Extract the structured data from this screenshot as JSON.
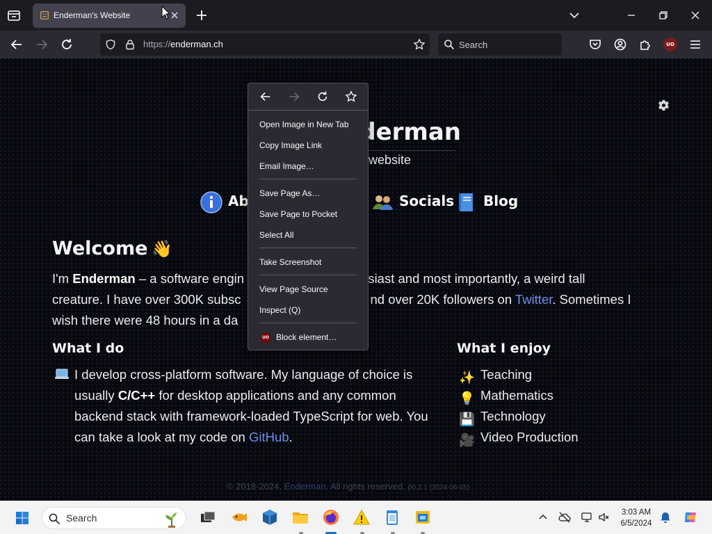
{
  "browser": {
    "tab": {
      "title": "Enderman's Website"
    },
    "url": {
      "protocol": "https://",
      "host": "enderman.ch"
    },
    "search_placeholder": "Search",
    "ublock_badge": "UO"
  },
  "page": {
    "site_title": "nderman",
    "site_subtitle": "website",
    "nav": [
      {
        "label": "Abo"
      },
      {
        "label": "Socials"
      },
      {
        "label": "Blog"
      }
    ],
    "welcome": {
      "heading": "Welcome",
      "emoji": "👋"
    },
    "intro": {
      "p1": "I'm ",
      "name": "Enderman",
      "p2": " – a software engin",
      "p3": "usiast and most importantly, a weird tall",
      "p4": "creature. I have over 300K subsc",
      "p5": "nd over 20K followers on ",
      "twitter": "Twitter",
      "p6": ". Sometimes I",
      "p7": "wish there were 48 hours in a da"
    },
    "what_i_do": {
      "heading": "What I do",
      "t1": "I develop cross-platform software. My language of choice is usually ",
      "lang": "C/C++",
      "t2": " for desktop applications and any common backend stack with framework-loaded TypeScript for web. You can take a look at my code on ",
      "github": "GitHub",
      "t3": "."
    },
    "what_i_enjoy": {
      "heading": "What I enjoy",
      "items": [
        {
          "icon": "✨",
          "label": "Teaching"
        },
        {
          "icon": "💡",
          "label": "Mathematics"
        },
        {
          "icon": "💾",
          "label": "Technology"
        },
        {
          "icon": "🎥",
          "label": "Video Production"
        }
      ]
    },
    "footer": {
      "copyright": "© 2018-2024, ",
      "link": "Enderman",
      "rights": ". All rights reserved.",
      "version": "β0.2.1 (2024-06-05)"
    }
  },
  "context_menu": {
    "items": {
      "open_image": "Open Image in New Tab",
      "copy_image_link": "Copy Image Link",
      "email_image": "Email Image…",
      "save_page_as": "Save Page As…",
      "save_to_pocket": "Save Page to Pocket",
      "select_all": "Select All",
      "take_screenshot": "Take Screenshot",
      "view_source": "View Page Source",
      "inspect": "Inspect (Q)",
      "block_element": "Block element…"
    },
    "ublock_badge": "UO"
  },
  "taskbar": {
    "search_label": "Search",
    "clock": {
      "time": "3:03 AM",
      "date": "6/5/2024"
    }
  },
  "colors": {
    "tab_active": "#42414d",
    "toolbar": "#2b2a33",
    "link": "#6d8fe6",
    "taskbar": "#f3f3f3"
  }
}
